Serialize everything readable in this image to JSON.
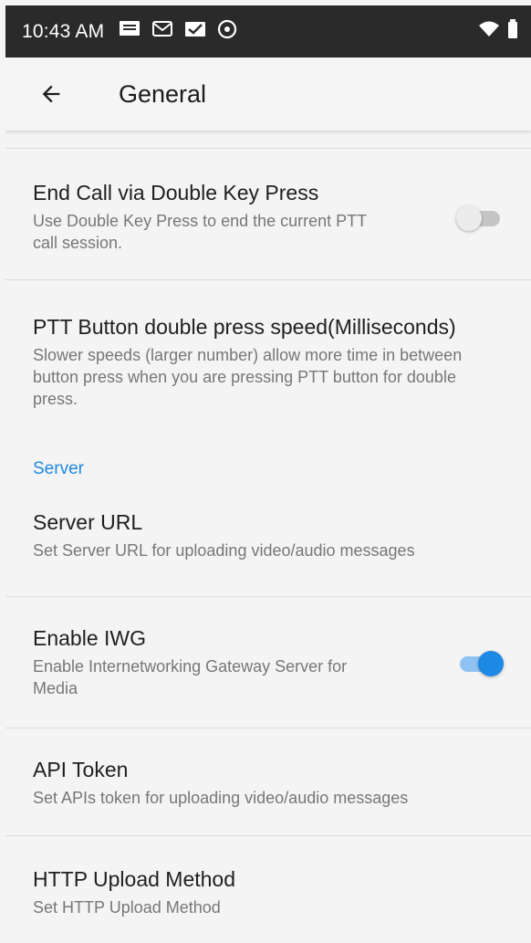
{
  "status_bar": {
    "time": "10:43 AM",
    "icons": [
      "message-icon",
      "mail-icon",
      "check-mail-icon",
      "sync-icon"
    ],
    "right_icons": [
      "wifi-icon",
      "battery-icon"
    ]
  },
  "app_bar": {
    "title": "General",
    "back_icon": "arrow-back-icon"
  },
  "preferences": {
    "end_call": {
      "title": "End Call via Double Key Press",
      "summary": "Use Double Key Press to end the current PTT call session.",
      "enabled": false
    },
    "double_press_speed": {
      "title": "PTT Button double press speed(Milliseconds)",
      "summary": "Slower speeds (larger number) allow more time in between button press when you are pressing PTT button for double press."
    },
    "server_category": "Server",
    "server_url": {
      "title": "Server URL",
      "summary": "Set Server URL for uploading video/audio messages"
    },
    "enable_iwg": {
      "title": "Enable IWG",
      "summary": "Enable Internetworking Gateway Server for Media",
      "enabled": true
    },
    "api_token": {
      "title": "API Token",
      "summary": "Set APIs token for uploading video/audio messages"
    },
    "http_upload": {
      "title": "HTTP Upload Method",
      "summary": "Set HTTP Upload Method"
    }
  },
  "colors": {
    "accent": "#1e88e5",
    "status_bar": "#2a2a2a",
    "background": "#f4f4f4"
  }
}
